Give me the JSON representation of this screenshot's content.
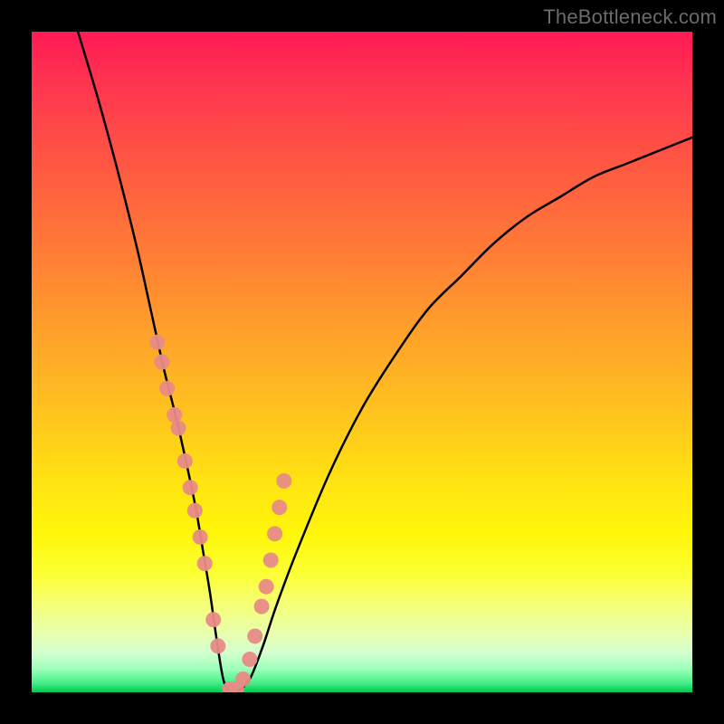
{
  "watermark": "TheBottleneck.com",
  "chart_data": {
    "type": "line",
    "title": "",
    "xlabel": "",
    "ylabel": "",
    "xlim": [
      0,
      100
    ],
    "ylim": [
      0,
      100
    ],
    "series": [
      {
        "name": "bottleneck-curve",
        "x": [
          7,
          10,
          13,
          16,
          18,
          20,
          22,
          24,
          25,
          26,
          27,
          28,
          29,
          30,
          31,
          33,
          35,
          37,
          40,
          45,
          50,
          55,
          60,
          65,
          70,
          75,
          80,
          85,
          90,
          95,
          100
        ],
        "y": [
          100,
          90,
          79,
          67,
          58,
          49,
          41,
          32,
          27,
          21,
          15,
          8,
          2,
          0,
          0,
          2,
          7,
          13,
          21,
          33,
          43,
          51,
          58,
          63,
          68,
          72,
          75,
          78,
          80,
          82,
          84
        ]
      }
    ],
    "markers": {
      "name": "highlight-points",
      "color": "#e88b87",
      "x": [
        19.0,
        19.7,
        20.5,
        21.6,
        22.2,
        23.2,
        24.0,
        24.7,
        25.5,
        26.2,
        27.5,
        28.2,
        30.0,
        31.0,
        32.0,
        33.0,
        33.8,
        34.8,
        35.5,
        36.2,
        36.8,
        37.5,
        38.2
      ],
      "y": [
        53.0,
        50.0,
        46.0,
        42.0,
        40.0,
        35.0,
        31.0,
        27.5,
        23.5,
        19.5,
        11.0,
        7.0,
        0.5,
        0.5,
        2.0,
        5.0,
        8.5,
        13.0,
        16.0,
        20.0,
        24.0,
        28.0,
        32.0
      ]
    }
  }
}
